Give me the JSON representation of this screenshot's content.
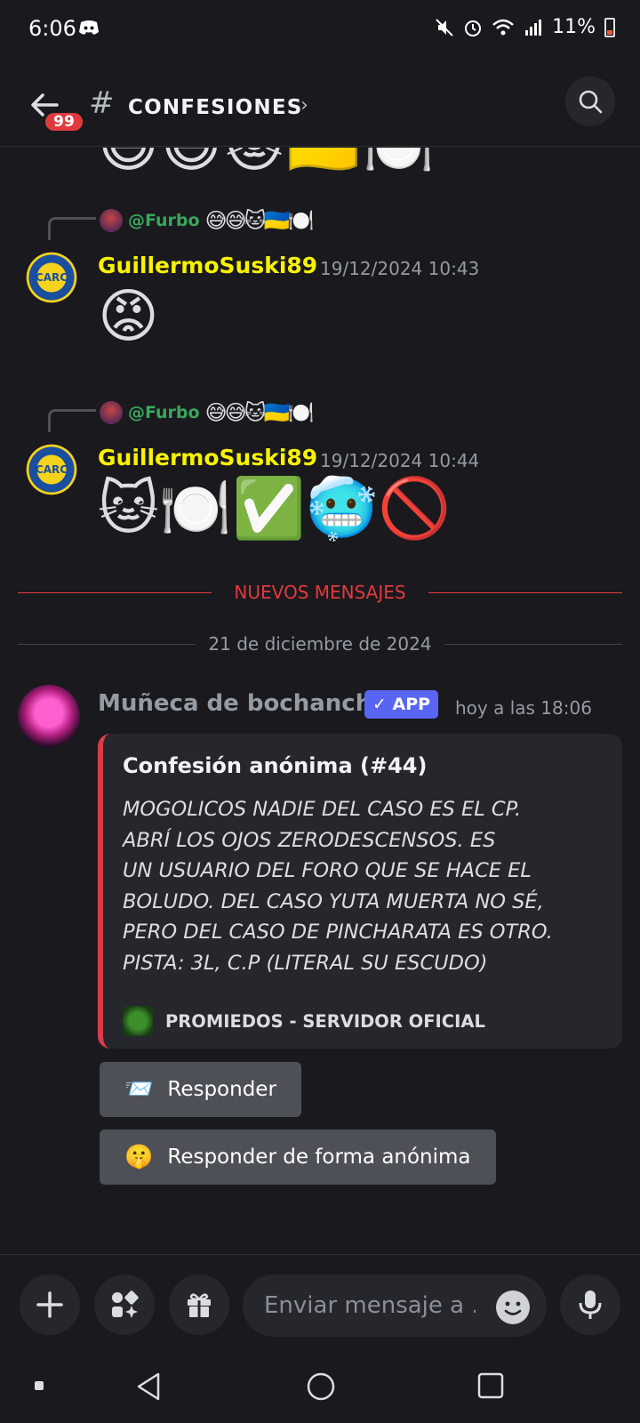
{
  "status_bar": {
    "time": "6:06",
    "battery": "11%"
  },
  "header": {
    "back_badge": "99",
    "channel_name": "CONFESIONES",
    "hash_symbol": "#"
  },
  "messages": [
    {
      "reply_mention": "@Furbo",
      "reply_emojis": "😅😅🐱🇺🇦🍽️",
      "username": "GuillermoSuski89",
      "timestamp": "19/12/2024 10:43",
      "content_emojis": [
        "😡"
      ]
    },
    {
      "reply_mention": "@Furbo",
      "reply_emojis": "😅😅🐱🇺🇦🍽️",
      "username": "GuillermoSuski89",
      "timestamp": "19/12/2024 10:44",
      "content_emojis": [
        "🐱",
        "🍽️",
        "✅",
        "🥶",
        "🚫"
      ]
    }
  ],
  "top_cut_emojis": [
    "😅",
    "😅",
    "🐱",
    "🇺🇦",
    "🍽️"
  ],
  "new_messages_divider": "NUEVOS MENSAJES",
  "date_divider": "21 de diciembre de 2024",
  "bot_message": {
    "username": "Muñeca de bochancho",
    "badge": "✓ APP",
    "timestamp": "hoy a las 18:06",
    "embed": {
      "title": "Confesión anónima (#44)",
      "lines": [
        "MOGOLICOS NADIE DEL CASO ES EL CP.",
        "ABRÍ LOS OJOS ZERODESCENSOS.  ES",
        "UN USUARIO DEL FORO QUE SE HACE EL",
        "BOLUDO. DEL CASO YUTA MUERTA NO SÉ,",
        "PERO DEL CASO DE PINCHARATA ES OTRO.",
        "PISTA: 3L, C.P (LITERAL SU ESCUDO)"
      ],
      "footer": "PROMIEDOS - SERVIDOR OFICIAL",
      "accent_color": "#d83b49"
    },
    "buttons": [
      {
        "emoji": "📨",
        "label": "Responder"
      },
      {
        "emoji": "🤫",
        "label": "Responder de forma anónima"
      }
    ]
  },
  "input": {
    "placeholder": "Enviar mensaje a ..."
  },
  "colors": {
    "username": "#f6f200",
    "mention": "#3ba55d",
    "new_divider": "#e03a3e",
    "app_badge": "#5865f2"
  }
}
